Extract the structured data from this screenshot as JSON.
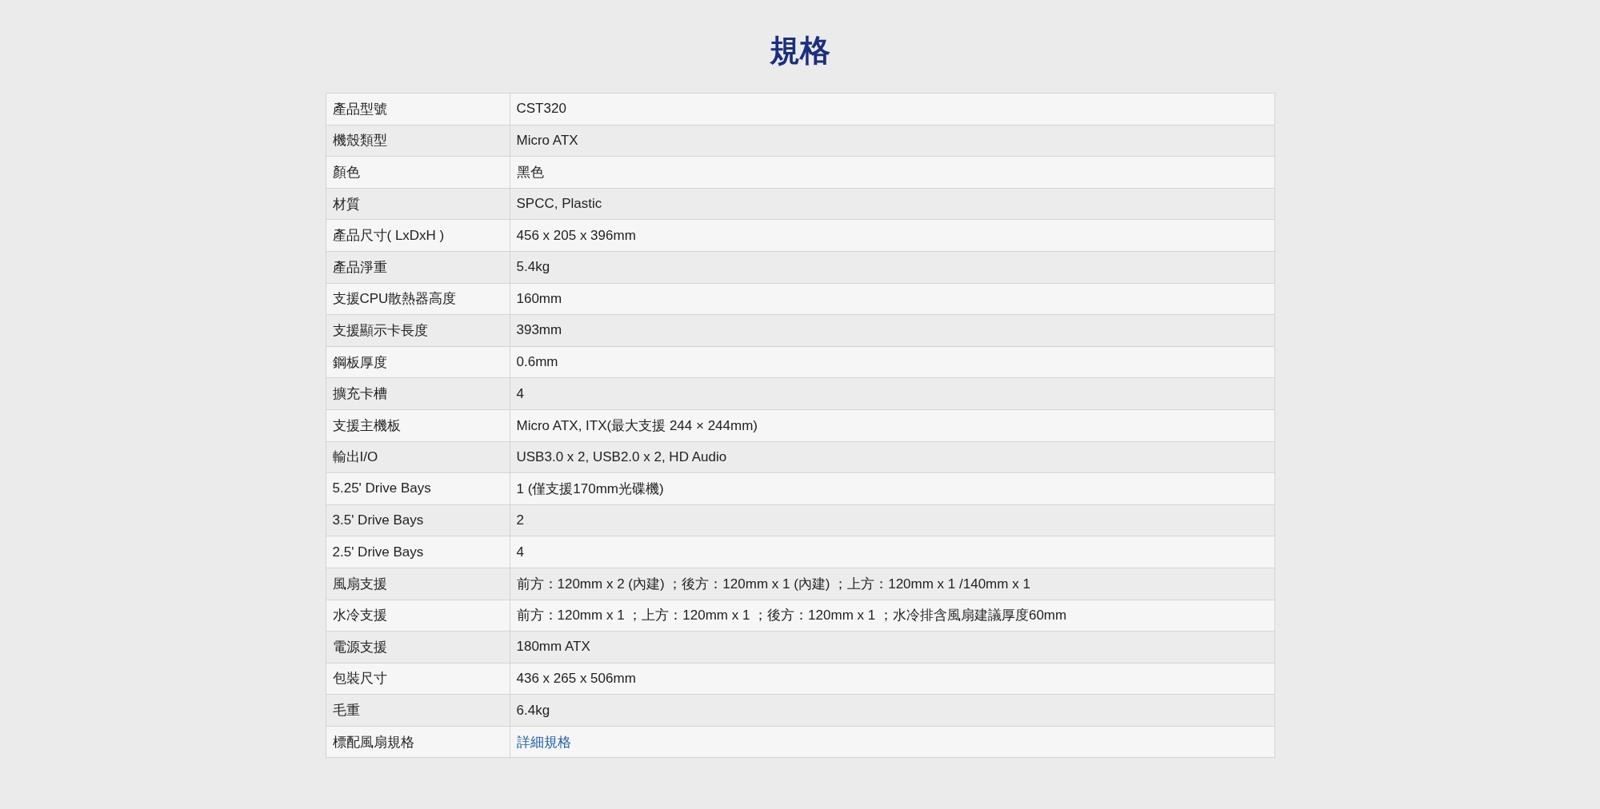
{
  "title": "規格",
  "specs": [
    {
      "label": "產品型號",
      "value": "CST320",
      "kind": "text"
    },
    {
      "label": "機殼類型",
      "value": "Micro ATX",
      "kind": "text"
    },
    {
      "label": "顏色",
      "value": "黑色",
      "kind": "text"
    },
    {
      "label": "材質",
      "value": "SPCC, Plastic",
      "kind": "text"
    },
    {
      "label": "產品尺寸( LxDxH )",
      "value": "456 x 205 x 396mm",
      "kind": "text"
    },
    {
      "label": "產品淨重",
      "value": "5.4kg",
      "kind": "text"
    },
    {
      "label": "支援CPU散熱器高度",
      "value": "160mm",
      "kind": "text"
    },
    {
      "label": "支援顯示卡長度",
      "value": "393mm",
      "kind": "text"
    },
    {
      "label": "鋼板厚度",
      "value": "0.6mm",
      "kind": "text"
    },
    {
      "label": "擴充卡槽",
      "value": "4",
      "kind": "text"
    },
    {
      "label": "支援主機板",
      "value": "Micro ATX, ITX(最大支援 244 × 244mm)",
      "kind": "text"
    },
    {
      "label": "輸出I/O",
      "value": "USB3.0 x 2, USB2.0 x 2, HD Audio",
      "kind": "text"
    },
    {
      "label": "5.25' Drive Bays",
      "value": "1 (僅支援170mm光碟機)",
      "kind": "text"
    },
    {
      "label": "3.5' Drive Bays",
      "value": "2",
      "kind": "text"
    },
    {
      "label": "2.5' Drive Bays",
      "value": "4",
      "kind": "text"
    },
    {
      "label": "風扇支援",
      "value": "前方：120mm x 2 (內建) ；後方：120mm x 1 (內建) ；上方：120mm x 1 /140mm x 1",
      "kind": "text"
    },
    {
      "label": "水冷支援",
      "value": "前方：120mm x 1 ；上方：120mm x 1 ；後方：120mm x 1 ；水冷排含風扇建議厚度60mm",
      "kind": "text"
    },
    {
      "label": "電源支援",
      "value": "180mm ATX",
      "kind": "text"
    },
    {
      "label": "包裝尺寸",
      "value": "436 x 265 x 506mm",
      "kind": "text"
    },
    {
      "label": "毛重",
      "value": "6.4kg",
      "kind": "text"
    },
    {
      "label": "標配風扇規格",
      "value": "詳細規格",
      "kind": "link"
    }
  ]
}
